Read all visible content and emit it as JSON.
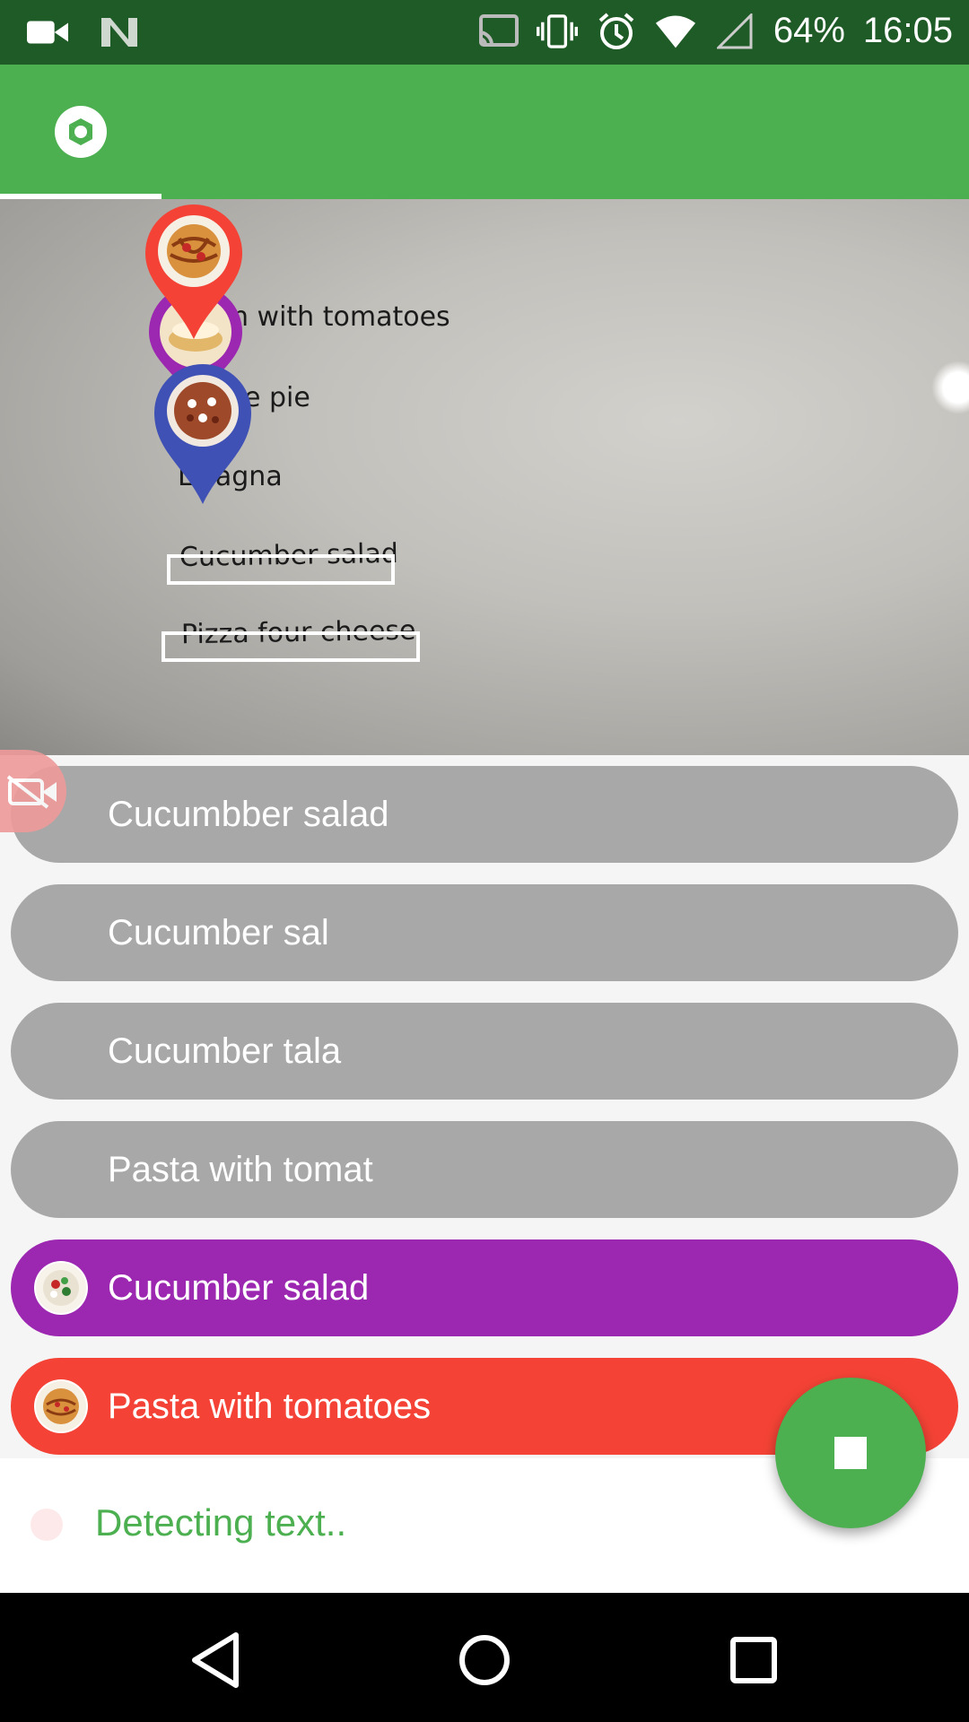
{
  "status_bar": {
    "battery_text": "64%",
    "time": "16:05",
    "icons": [
      "video-camera-icon",
      "n-icon",
      "cast-icon",
      "vibrate-icon",
      "alarm-icon",
      "wifi-icon",
      "signal-icon"
    ]
  },
  "app_bar": {
    "tab_icon": "camera-aperture-icon",
    "color": "#4caf50"
  },
  "preview": {
    "lines": [
      "n with tomatoes",
      "e pie",
      "L sagna",
      "Cucumber salad",
      "Pizza four cheese"
    ],
    "pin_colors": [
      "#f44336",
      "#9c27b0",
      "#3f51b5"
    ]
  },
  "results": [
    {
      "label": "Cucumbber salad",
      "style": "gray",
      "has_thumb": false
    },
    {
      "label": "Cucumber sal",
      "style": "gray",
      "has_thumb": false
    },
    {
      "label": "Cucumber tala",
      "style": "gray",
      "has_thumb": false
    },
    {
      "label": "Pasta with tomat",
      "style": "gray",
      "has_thumb": false
    },
    {
      "label": "Cucumber salad",
      "style": "purple",
      "has_thumb": true
    },
    {
      "label": "Pasta with tomatoes",
      "style": "red",
      "has_thumb": true
    }
  ],
  "bottom": {
    "status": "Detecting text..",
    "fab_icon": "stop-icon"
  },
  "nav": {
    "icons": [
      "back-icon",
      "home-icon",
      "recents-icon"
    ]
  }
}
